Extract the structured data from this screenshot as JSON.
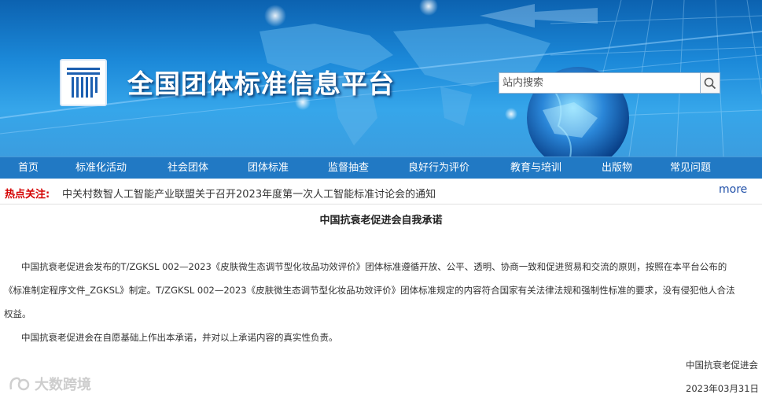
{
  "header": {
    "site_title": "全国团体标准信息平台",
    "logo_icon": "standards-logo-icon",
    "search": {
      "placeholder": "站内搜索",
      "value": "",
      "button_icon": "search-icon"
    }
  },
  "nav": {
    "items": [
      {
        "label": "首页"
      },
      {
        "label": "标准化活动"
      },
      {
        "label": "社会团体"
      },
      {
        "label": "团体标准"
      },
      {
        "label": "监督抽查"
      },
      {
        "label": "良好行为评价"
      },
      {
        "label": "教育与培训"
      },
      {
        "label": "出版物"
      },
      {
        "label": "常见问题"
      }
    ]
  },
  "hot": {
    "label": "热点关注:",
    "text": "中关村数智人工智能产业联盟关于召开2023年度第一次人工智能标准讨论会的通知",
    "more": "more"
  },
  "article": {
    "title": "中国抗衰老促进会自我承诺",
    "p1_lines": [
      "中国抗衰老促进会发布的T/ZGKSL 002—2023《皮肤微生态调节型化妆品功效评价》团体标准遵循开放、公平、透明、协商一致和促进贸易和交流的原则，按照在本平台公布的",
      "《标准制定程序文件_ZGKSL》制定。T/ZGKSL 002—2023《皮肤微生态调节型化妆品功效评价》团体标准规定的内容符合国家有关法律法规和强制性标准的要求，没有侵犯他人合法",
      "权益。"
    ],
    "p2": "中国抗衰老促进会在自愿基础上作出本承诺，并对以上承诺内容的真实性负责。",
    "signer": "中国抗衰老促进会",
    "date": "2023年03月31日"
  },
  "watermark": {
    "text": "大数跨境",
    "icon": "watermark-logo-icon"
  },
  "colors": {
    "nav_bg": "#2179c4",
    "banner": "#1b88d8",
    "hot_label": "#d40000",
    "more_link": "#1f4fa8"
  }
}
